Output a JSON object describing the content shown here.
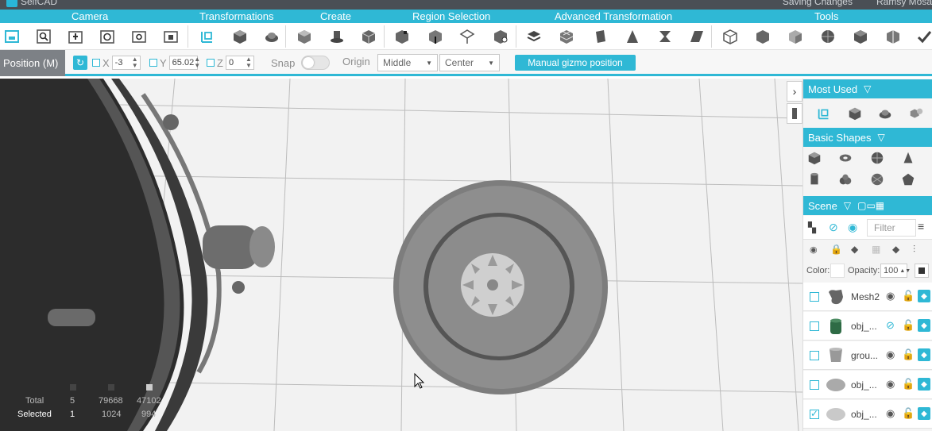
{
  "titlebar": {
    "app_name": "SelfCAD",
    "saving": "Saving Changes",
    "user": "Ramsy Mosa"
  },
  "categories": [
    "Camera",
    "Transformations",
    "Create",
    "Region Selection",
    "Advanced Transformation",
    "Tools"
  ],
  "gizmo": {
    "mode_label": "Position (M)",
    "x_label": "X",
    "x_value": "-3",
    "y_label": "Y",
    "y_value": "65.02",
    "z_label": "Z",
    "z_value": "0",
    "snap_label": "Snap",
    "origin_label": "Origin",
    "origin_options": [
      "Middle",
      "Center"
    ],
    "manual_button": "Manual gizmo position"
  },
  "stats": {
    "total_label": "Total",
    "total_objects": "5",
    "total_vertices": "79668",
    "total_faces": "47102",
    "selected_label": "Selected",
    "selected_objects": "1",
    "selected_vertices": "1024",
    "selected_faces": "994"
  },
  "panel": {
    "most_used": "Most Used",
    "basic_shapes": "Basic Shapes",
    "scene": "Scene",
    "filter_placeholder": "Filter",
    "color_label": "Color:",
    "opacity_label": "Opacity:",
    "opacity_value": "100",
    "objects": [
      {
        "name": "Mesh2",
        "checked": false
      },
      {
        "name": "obj_...",
        "checked": false
      },
      {
        "name": "grou...",
        "checked": false
      },
      {
        "name": "obj_...",
        "checked": false
      },
      {
        "name": "obj_...",
        "checked": true
      }
    ]
  },
  "colors": {
    "accent": "#2fb8d5",
    "dark": "#4a4f55",
    "model": "#8a8a8a"
  }
}
